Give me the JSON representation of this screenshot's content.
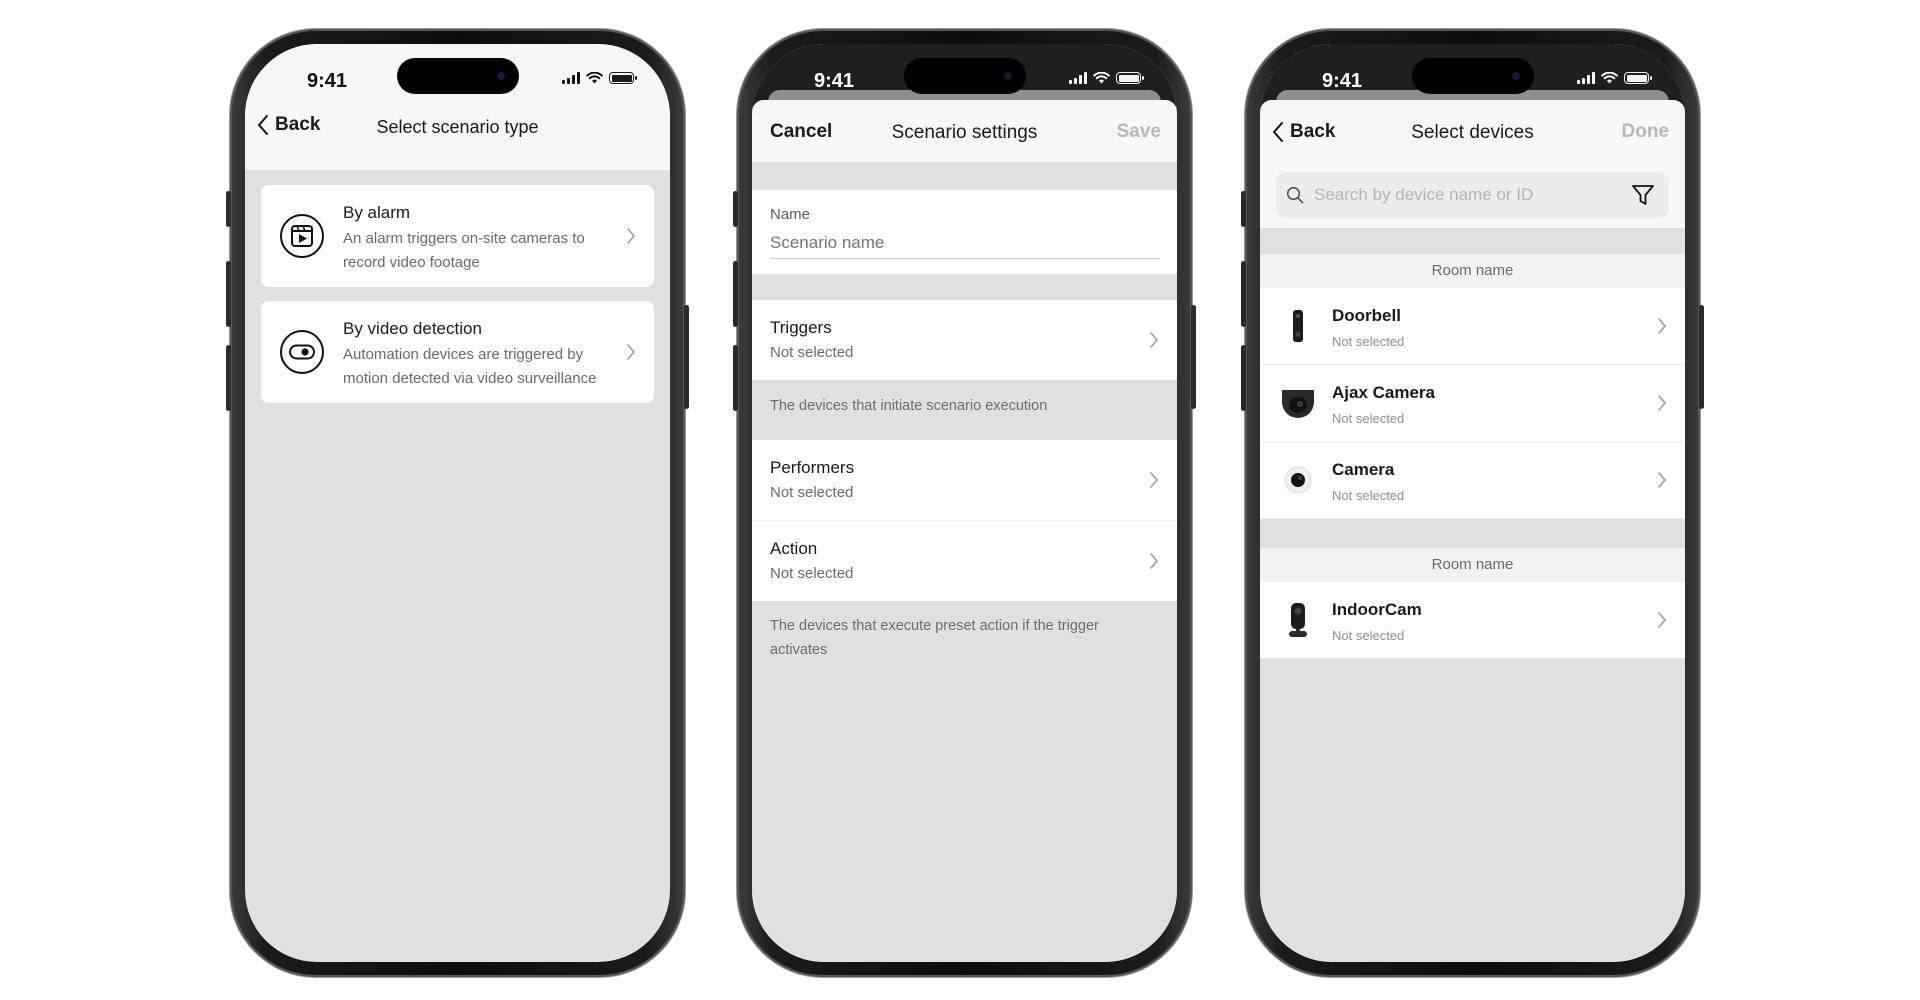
{
  "status_bar": {
    "time": "9:41"
  },
  "screen1": {
    "back_label": "Back",
    "title": "Select scenario type",
    "options": [
      {
        "title": "By alarm",
        "description": "An alarm triggers on-site cameras to record video footage",
        "icon": "video-play-icon"
      },
      {
        "title": "By video detection",
        "description": "Automation devices are triggered by motion detected via video surveillance",
        "icon": "eye-icon"
      }
    ]
  },
  "screen2": {
    "cancel_label": "Cancel",
    "title": "Scenario settings",
    "save_label": "Save",
    "name_label": "Name",
    "name_placeholder": "Scenario name",
    "triggers": {
      "label": "Triggers",
      "value": "Not selected"
    },
    "triggers_note": "The devices that initiate scenario execution",
    "performers": {
      "label": "Performers",
      "value": "Not selected"
    },
    "action": {
      "label": "Action",
      "value": "Not selected"
    },
    "action_note": "The devices that execute preset action if the trigger activates"
  },
  "screen3": {
    "back_label": "Back",
    "title": "Select devices",
    "done_label": "Done",
    "search_placeholder": "Search by device name or ID",
    "rooms": [
      {
        "name": "Room name",
        "devices": [
          {
            "name": "Doorbell",
            "status": "Not selected",
            "icon": "doorbell-icon"
          },
          {
            "name": "Ajax Camera",
            "status": "Not selected",
            "icon": "dome-camera-icon"
          },
          {
            "name": "Camera",
            "status": "Not selected",
            "icon": "bullet-camera-icon"
          }
        ]
      },
      {
        "name": "Room name",
        "devices": [
          {
            "name": "IndoorCam",
            "status": "Not selected",
            "icon": "indoor-camera-icon"
          }
        ]
      }
    ]
  }
}
